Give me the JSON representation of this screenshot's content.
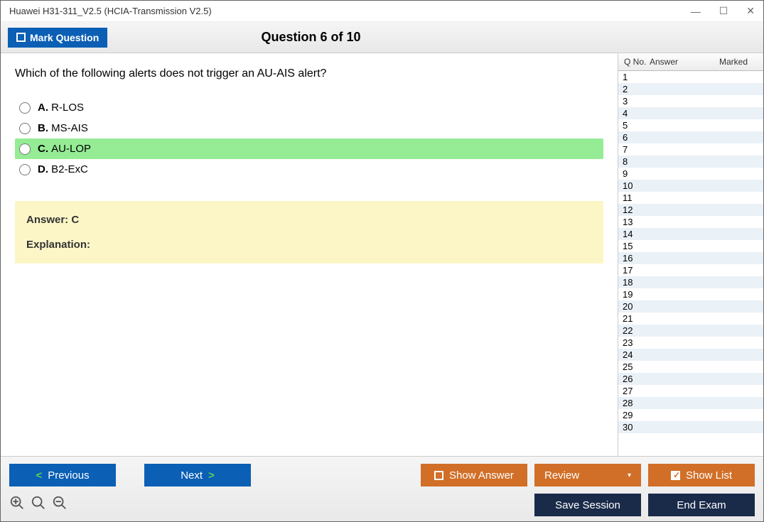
{
  "window": {
    "title": "Huawei H31-311_V2.5 (HCIA-Transmission V2.5)"
  },
  "header": {
    "mark_label": "Mark Question",
    "counter": "Question 6 of 10"
  },
  "question": {
    "text": "Which of the following alerts does not trigger an AU-AIS alert?",
    "options": [
      {
        "letter": "A.",
        "text": "R-LOS",
        "selected": false
      },
      {
        "letter": "B.",
        "text": "MS-AIS",
        "selected": false
      },
      {
        "letter": "C.",
        "text": "AU-LOP",
        "selected": true
      },
      {
        "letter": "D.",
        "text": "B2-ExC",
        "selected": false
      }
    ],
    "answer_label": "Answer: C",
    "explanation_label": "Explanation:"
  },
  "side": {
    "headers": {
      "qno": "Q No.",
      "answer": "Answer",
      "marked": "Marked"
    },
    "rows": [
      {
        "no": "1"
      },
      {
        "no": "2"
      },
      {
        "no": "3"
      },
      {
        "no": "4"
      },
      {
        "no": "5"
      },
      {
        "no": "6"
      },
      {
        "no": "7"
      },
      {
        "no": "8"
      },
      {
        "no": "9"
      },
      {
        "no": "10"
      },
      {
        "no": "11"
      },
      {
        "no": "12"
      },
      {
        "no": "13"
      },
      {
        "no": "14"
      },
      {
        "no": "15"
      },
      {
        "no": "16"
      },
      {
        "no": "17"
      },
      {
        "no": "18"
      },
      {
        "no": "19"
      },
      {
        "no": "20"
      },
      {
        "no": "21"
      },
      {
        "no": "22"
      },
      {
        "no": "23"
      },
      {
        "no": "24"
      },
      {
        "no": "25"
      },
      {
        "no": "26"
      },
      {
        "no": "27"
      },
      {
        "no": "28"
      },
      {
        "no": "29"
      },
      {
        "no": "30"
      }
    ]
  },
  "footer": {
    "previous": "Previous",
    "next": "Next",
    "show_answer": "Show Answer",
    "review": "Review",
    "show_list": "Show List",
    "save_session": "Save Session",
    "end_exam": "End Exam"
  }
}
